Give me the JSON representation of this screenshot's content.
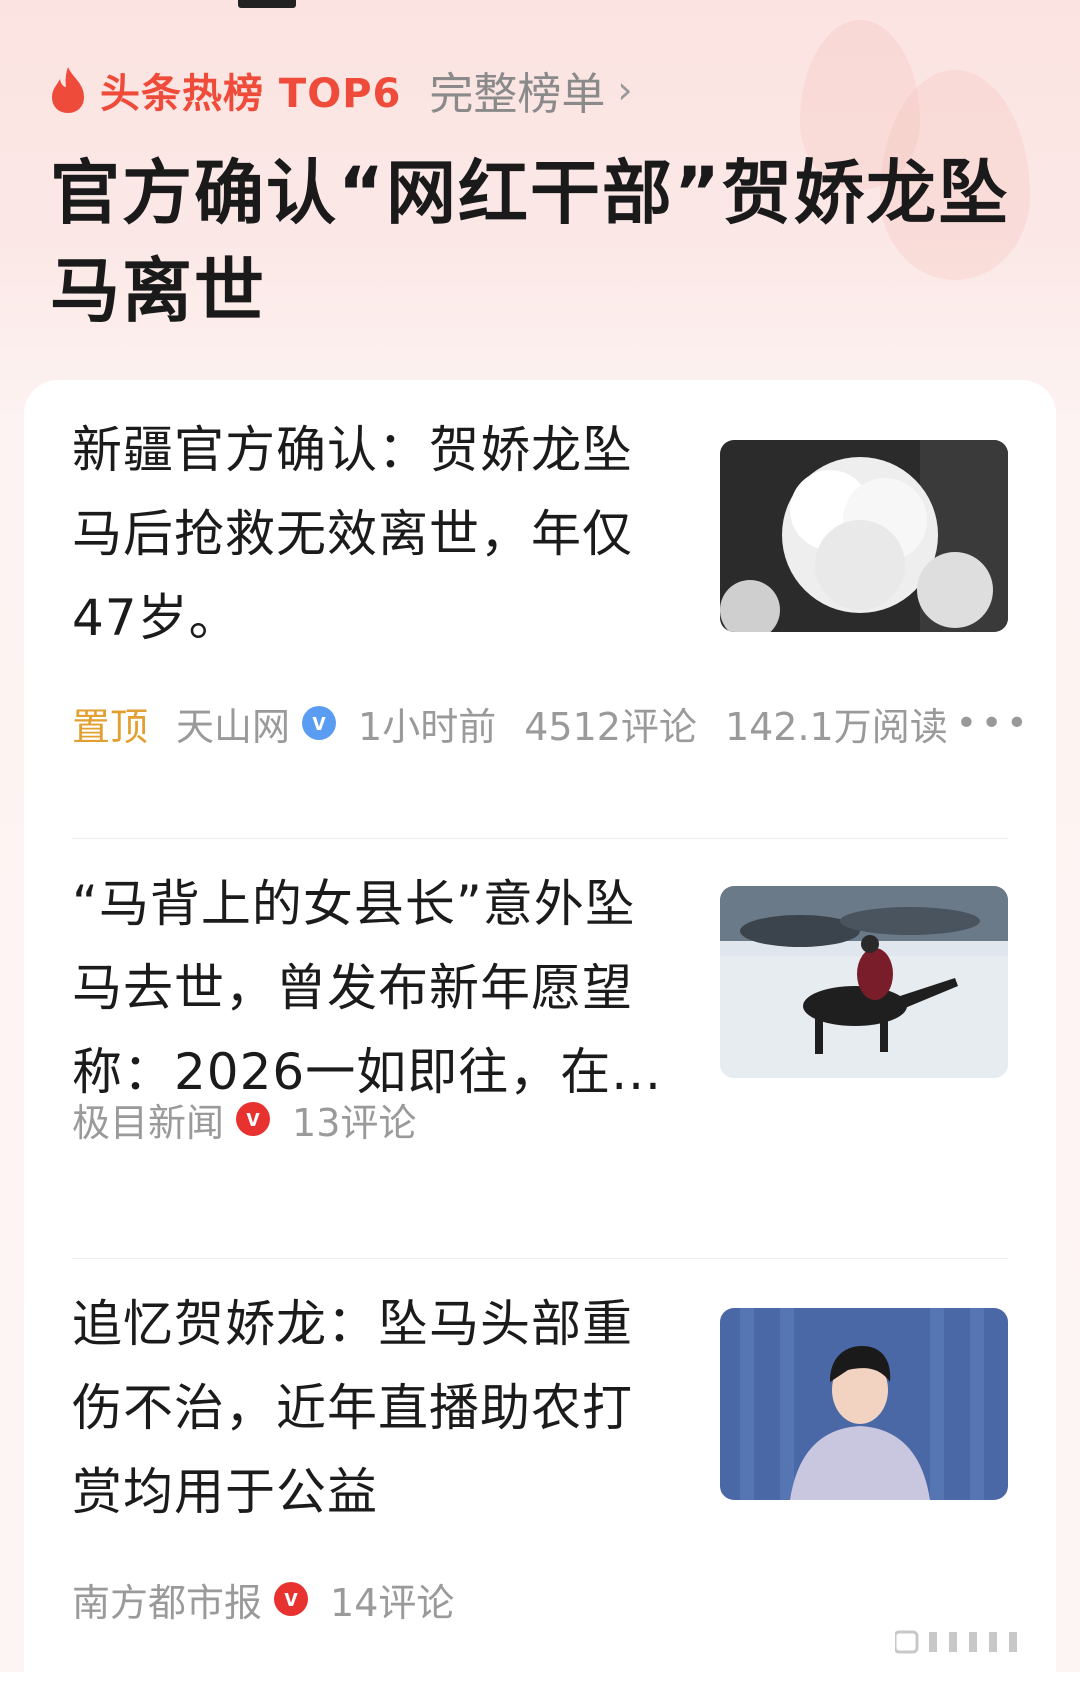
{
  "header": {
    "hot_label": "头条热榜 TOP6",
    "full_list_label": "完整榜单",
    "chevron_icon": "chevron-right-icon",
    "flame_icon": "flame-icon",
    "brand_color": "#ef4b3a"
  },
  "topic": {
    "title": "官方确认“网红干部”贺娇龙坠马离世"
  },
  "articles": [
    {
      "title": "新疆官方确认：贺娇龙坠马后抢救无效离世，年仅47岁。",
      "pinned_label": "置顶",
      "source": "天山网",
      "verified_badge": "v",
      "time": "1小时前",
      "comments": "4512评论",
      "reads": "142.1万阅读",
      "more_icon": "more-dots-icon",
      "image": "white-chrysanthemum-photo"
    },
    {
      "title": "“马背上的女县长”意外坠马去世，曾发布新年愿望称：2026一如即往，在...",
      "source": "极目新闻",
      "verified_badge": "v",
      "comments": "13评论",
      "image": "rider-on-snow-horses-photo"
    },
    {
      "title": "追忆贺娇龙：坠马头部重伤不治，近年直播助农打赏均用于公益",
      "source": "南方都市报",
      "verified_badge": "v",
      "comments": "14评论",
      "image": "woman-portrait-photo"
    }
  ]
}
